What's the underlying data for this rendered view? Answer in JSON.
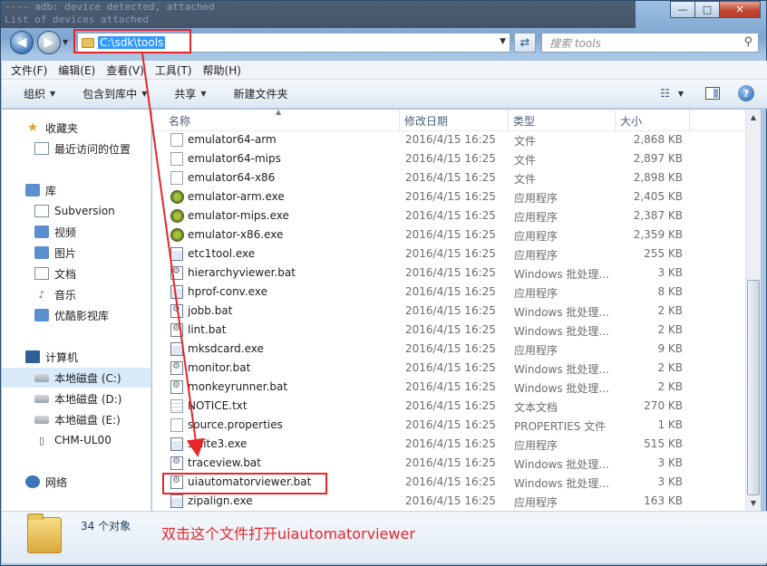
{
  "background_terminal": [
    "  ---- adb: device detected, attached",
    "     List of devices attached"
  ],
  "window_controls": {
    "minimize": "—",
    "maximize": "□",
    "close": "✕"
  },
  "address_bar": {
    "path": "C:\\sdk\\tools"
  },
  "search": {
    "placeholder": "搜索 tools"
  },
  "menu": [
    "文件(F)",
    "编辑(E)",
    "查看(V)",
    "工具(T)",
    "帮助(H)"
  ],
  "command_bar": [
    "组织",
    "包含到库中",
    "共享",
    "新建文件夹"
  ],
  "nav_pane": {
    "favorites": {
      "label": "收藏夹",
      "items": [
        "最近访问的位置"
      ]
    },
    "libraries": {
      "label": "库",
      "items": [
        "Subversion",
        "视频",
        "图片",
        "文档",
        "音乐",
        "优酷影视库"
      ]
    },
    "computer": {
      "label": "计算机",
      "items": [
        "本地磁盘 (C:)",
        "本地磁盘 (D:)",
        "本地磁盘 (E:)",
        "CHM-UL00"
      ]
    },
    "network": {
      "label": "网络"
    }
  },
  "columns": {
    "name": "名称",
    "date": "修改日期",
    "type": "类型",
    "size": "大小"
  },
  "files": [
    {
      "name": "emulator64-arm",
      "date": "2016/4/15 16:25",
      "type": "文件",
      "size": "2,868 KB",
      "icon": "file"
    },
    {
      "name": "emulator64-mips",
      "date": "2016/4/15 16:25",
      "type": "文件",
      "size": "2,897 KB",
      "icon": "file"
    },
    {
      "name": "emulator64-x86",
      "date": "2016/4/15 16:25",
      "type": "文件",
      "size": "2,898 KB",
      "icon": "file"
    },
    {
      "name": "emulator-arm.exe",
      "date": "2016/4/15 16:25",
      "type": "应用程序",
      "size": "2,405 KB",
      "icon": "emu"
    },
    {
      "name": "emulator-mips.exe",
      "date": "2016/4/15 16:25",
      "type": "应用程序",
      "size": "2,387 KB",
      "icon": "emu"
    },
    {
      "name": "emulator-x86.exe",
      "date": "2016/4/15 16:25",
      "type": "应用程序",
      "size": "2,359 KB",
      "icon": "emu"
    },
    {
      "name": "etc1tool.exe",
      "date": "2016/4/15 16:25",
      "type": "应用程序",
      "size": "255 KB",
      "icon": "exe"
    },
    {
      "name": "hierarchyviewer.bat",
      "date": "2016/4/15 16:25",
      "type": "Windows 批处理...",
      "size": "3 KB",
      "icon": "bat"
    },
    {
      "name": "hprof-conv.exe",
      "date": "2016/4/15 16:25",
      "type": "应用程序",
      "size": "8 KB",
      "icon": "exe"
    },
    {
      "name": "jobb.bat",
      "date": "2016/4/15 16:25",
      "type": "Windows 批处理...",
      "size": "2 KB",
      "icon": "bat"
    },
    {
      "name": "lint.bat",
      "date": "2016/4/15 16:25",
      "type": "Windows 批处理...",
      "size": "2 KB",
      "icon": "bat"
    },
    {
      "name": "mksdcard.exe",
      "date": "2016/4/15 16:25",
      "type": "应用程序",
      "size": "9 KB",
      "icon": "exe"
    },
    {
      "name": "monitor.bat",
      "date": "2016/4/15 16:25",
      "type": "Windows 批处理...",
      "size": "2 KB",
      "icon": "bat"
    },
    {
      "name": "monkeyrunner.bat",
      "date": "2016/4/15 16:25",
      "type": "Windows 批处理...",
      "size": "2 KB",
      "icon": "bat"
    },
    {
      "name": "NOTICE.txt",
      "date": "2016/4/15 16:25",
      "type": "文本文档",
      "size": "270 KB",
      "icon": "txt"
    },
    {
      "name": "source.properties",
      "date": "2016/4/15 16:25",
      "type": "PROPERTIES 文件",
      "size": "1 KB",
      "icon": "file"
    },
    {
      "name": "sqlite3.exe",
      "date": "2016/4/15 16:25",
      "type": "应用程序",
      "size": "515 KB",
      "icon": "exe"
    },
    {
      "name": "traceview.bat",
      "date": "2016/4/15 16:25",
      "type": "Windows 批处理...",
      "size": "3 KB",
      "icon": "bat"
    },
    {
      "name": "uiautomatorviewer.bat",
      "date": "2016/4/15 16:25",
      "type": "Windows 批处理...",
      "size": "3 KB",
      "icon": "bat"
    },
    {
      "name": "zipalign.exe",
      "date": "2016/4/15 16:25",
      "type": "应用程序",
      "size": "163 KB",
      "icon": "exe"
    }
  ],
  "details": {
    "count": "34 个对象"
  },
  "annotation": "双击这个文件打开uiautomatorviewer",
  "colors": {
    "annotation_red": "#e8252a",
    "selection_blue": "#3399ff"
  }
}
